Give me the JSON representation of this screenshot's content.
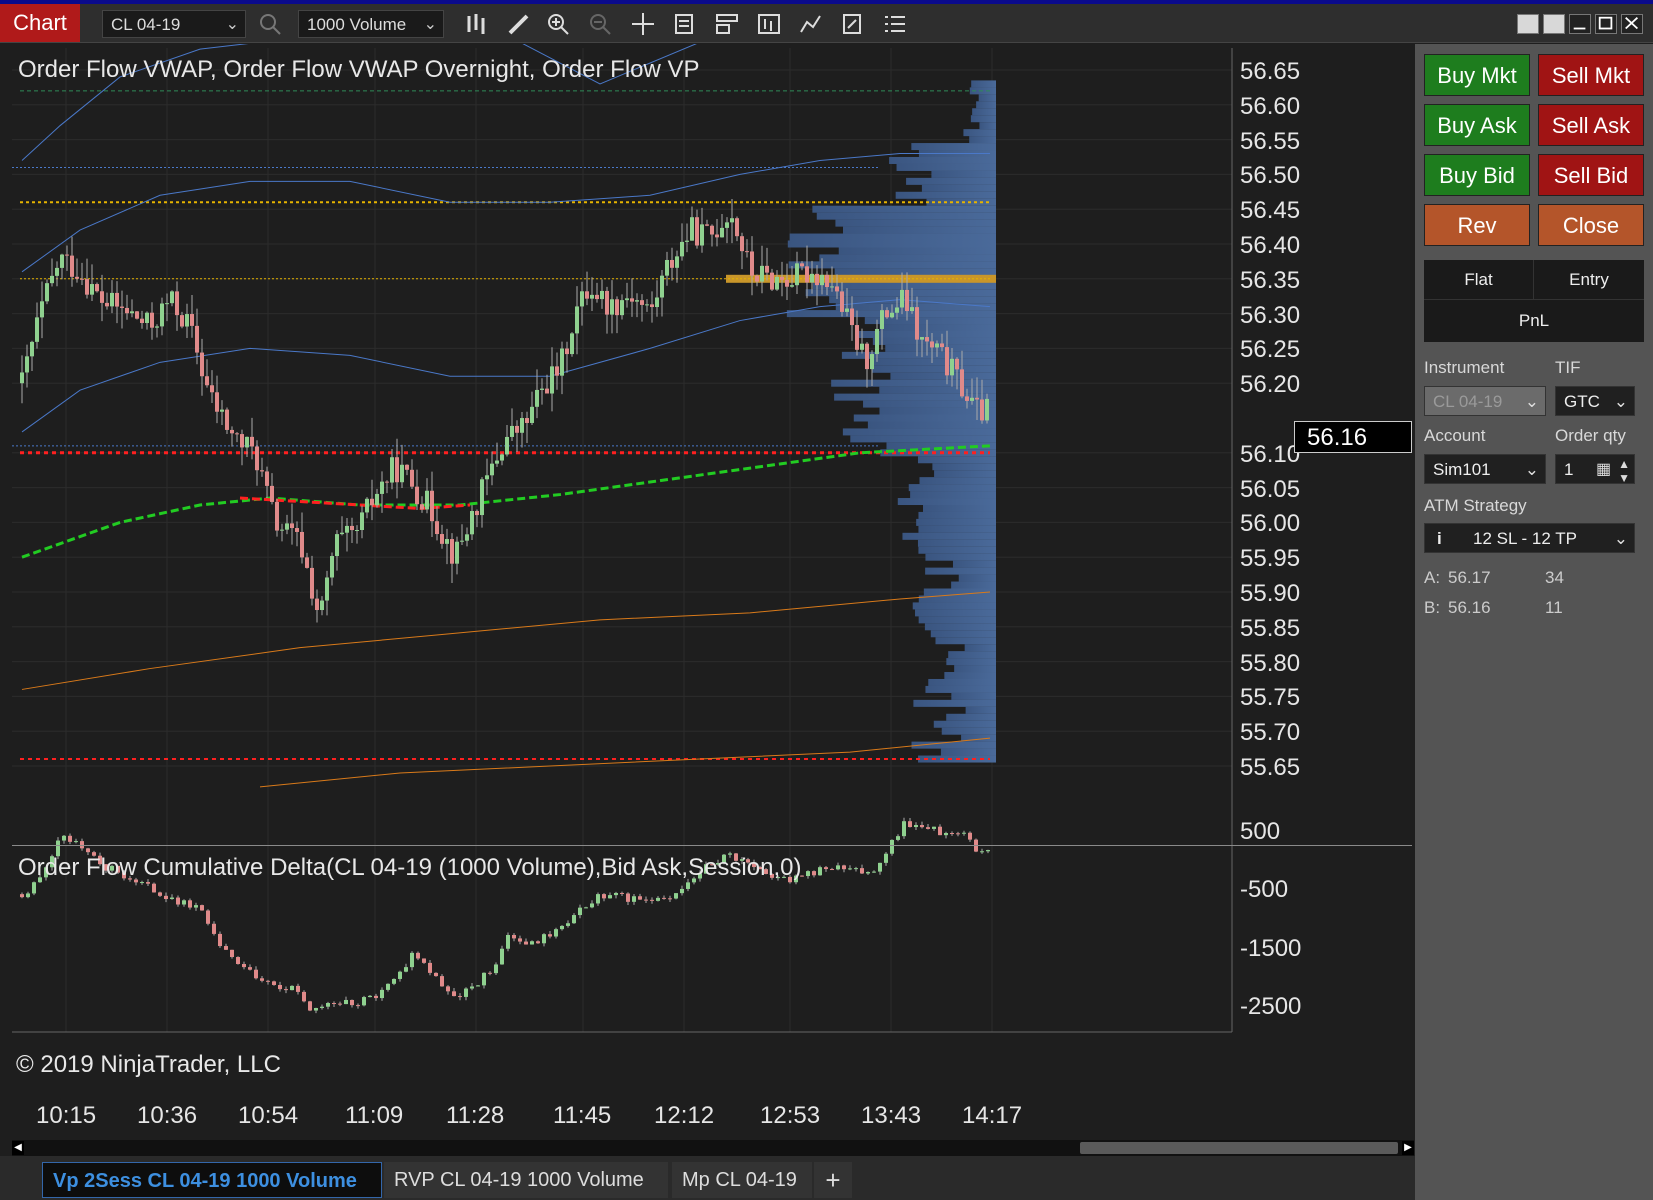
{
  "titlebar": {
    "tab_label": "Chart",
    "instrument": "CL 04-19",
    "interval": "1000 Volume"
  },
  "price_panel": {
    "title": "Order Flow VWAP, Order Flow VWAP Overnight, Order Flow VP",
    "y_ticks": [
      "56.65",
      "56.60",
      "56.55",
      "56.50",
      "56.45",
      "56.40",
      "56.35",
      "56.30",
      "56.25",
      "56.20",
      "56.10",
      "56.05",
      "56.00",
      "55.95",
      "55.90",
      "55.85",
      "55.80",
      "55.75",
      "55.70",
      "55.65"
    ],
    "last_price": "56.16"
  },
  "delta_panel": {
    "title": "Order Flow Cumulative Delta(CL 04-19 (1000 Volume),Bid Ask,Session,0)",
    "y_ticks": [
      "500",
      "-500",
      "-1500",
      "-2500"
    ],
    "copyright": "© 2019 NinjaTrader, LLC"
  },
  "x_ticks": [
    "10:15",
    "10:36",
    "10:54",
    "11:09",
    "11:28",
    "11:45",
    "12:12",
    "12:53",
    "13:43",
    "14:17"
  ],
  "order_panel": {
    "buy_mkt": "Buy Mkt",
    "sell_mkt": "Sell Mkt",
    "buy_ask": "Buy Ask",
    "sell_ask": "Sell Ask",
    "buy_bid": "Buy Bid",
    "sell_bid": "Sell Bid",
    "rev": "Rev",
    "close": "Close",
    "flat": "Flat",
    "entry": "Entry",
    "pnl": "PnL",
    "instrument_label": "Instrument",
    "instrument_value": "CL 04-19",
    "tif_label": "TIF",
    "tif_value": "GTC",
    "account_label": "Account",
    "account_value": "Sim101",
    "qty_label": "Order qty",
    "qty_value": "1",
    "atm_label": "ATM Strategy",
    "atm_value": "12 SL - 12 TP",
    "ask_label": "A:",
    "ask_price": "56.17",
    "ask_size": "34",
    "bid_label": "B:",
    "bid_price": "56.16",
    "bid_size": "11"
  },
  "bottom_tabs": [
    "Vp 2Sess CL 04-19 1000 Volume",
    "RVP CL 04-19 1000 Volume",
    "Mp CL 04-19"
  ],
  "add_tab": "+",
  "colors": {
    "up_candle": "#8fd18f",
    "down_candle": "#e08a8a",
    "vwap": "#22cc22",
    "band": "#4a78c8",
    "overnight": "#d97a1a",
    "level_red": "#ff2020",
    "level_yellow": "#e6b400",
    "profile": "#3d5a8a"
  }
}
